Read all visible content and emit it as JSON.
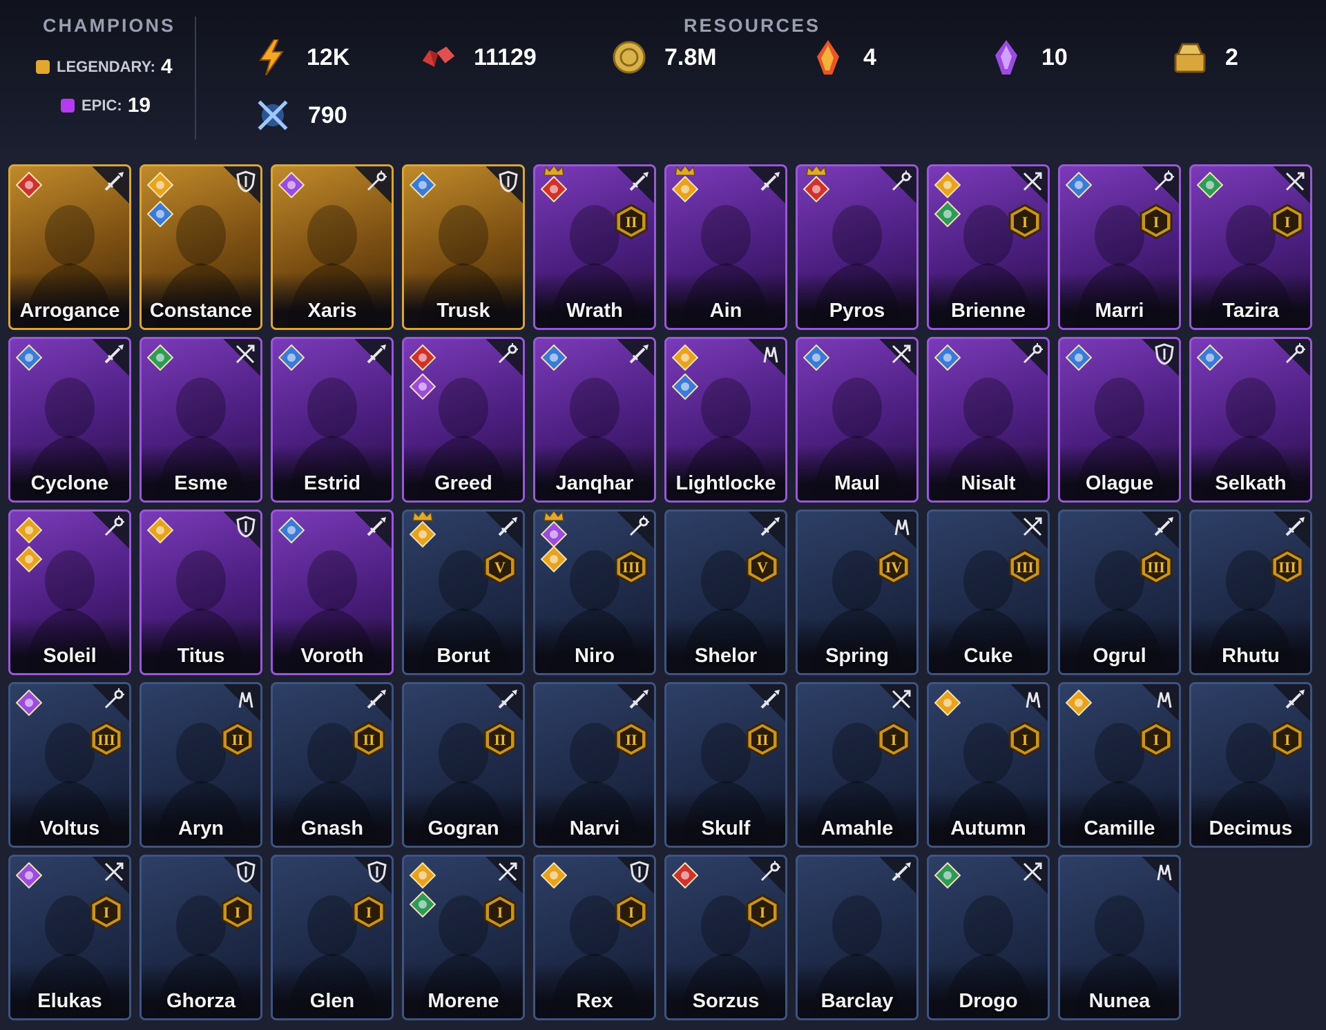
{
  "header": {
    "champions_title": "CHAMPIONS",
    "resources_title": "RESOURCES",
    "legendary_label": "LEGENDARY:",
    "legendary_count": "4",
    "epic_label": "EPIC:",
    "epic_count": "19",
    "resources": [
      {
        "icon": "lightning-energy-icon",
        "value": "12K"
      },
      {
        "icon": "red-gem-icon",
        "value": "11129"
      },
      {
        "icon": "gold-coin-icon",
        "value": "7.8M"
      },
      {
        "icon": "fire-shard-icon",
        "value": "4"
      },
      {
        "icon": "void-shard-icon",
        "value": "10"
      },
      {
        "icon": "gold-chest-icon",
        "value": "2"
      },
      {
        "icon": "crossed-swords-arena-icon",
        "value": "790"
      }
    ]
  },
  "colors": {
    "legendary": "#e0a82e",
    "epic": "#b33bf2",
    "rare": "#3e5482"
  },
  "champions": [
    {
      "name": "Arrogance",
      "rarity": "legendary",
      "affinity": "force",
      "role": "attack",
      "rank": ""
    },
    {
      "name": "Constance",
      "rarity": "legendary",
      "affinity": "spirit",
      "affinity2": "magic",
      "role": "defense",
      "rank": ""
    },
    {
      "name": "Xaris",
      "rarity": "legendary",
      "affinity": "void",
      "role": "support",
      "rank": ""
    },
    {
      "name": "Trusk",
      "rarity": "legendary",
      "affinity": "magic",
      "role": "defense",
      "rank": ""
    },
    {
      "name": "Wrath",
      "rarity": "epic",
      "affinity": "force",
      "role": "attack",
      "rank": "II",
      "crown": true
    },
    {
      "name": "Ain",
      "rarity": "epic",
      "affinity": "spirit",
      "role": "attack",
      "rank": "",
      "crown": true
    },
    {
      "name": "Pyros",
      "rarity": "epic",
      "affinity": "force",
      "role": "support",
      "rank": "",
      "crown": true
    },
    {
      "name": "Brienne",
      "rarity": "epic",
      "affinity": "spirit",
      "affinity2": "nature",
      "role": "ranged",
      "rank": "I"
    },
    {
      "name": "Marri",
      "rarity": "epic",
      "affinity": "magic",
      "role": "support",
      "rank": "I"
    },
    {
      "name": "Tazira",
      "rarity": "epic",
      "affinity": "nature",
      "role": "ranged",
      "rank": "I"
    },
    {
      "name": "Cyclone",
      "rarity": "epic",
      "affinity": "magic",
      "role": "attack",
      "rank": ""
    },
    {
      "name": "Esme",
      "rarity": "epic",
      "affinity": "nature",
      "role": "ranged",
      "rank": ""
    },
    {
      "name": "Estrid",
      "rarity": "epic",
      "affinity": "magic",
      "role": "attack",
      "rank": ""
    },
    {
      "name": "Greed",
      "rarity": "epic",
      "affinity": "force",
      "affinity2": "void",
      "role": "support",
      "rank": ""
    },
    {
      "name": "Janqhar",
      "rarity": "epic",
      "affinity": "magic",
      "role": "attack",
      "rank": ""
    },
    {
      "name": "Lightlocke",
      "rarity": "epic",
      "affinity": "spirit",
      "affinity2": "magic",
      "role": "heal",
      "rank": ""
    },
    {
      "name": "Maul",
      "rarity": "epic",
      "affinity": "magic",
      "role": "ranged",
      "rank": ""
    },
    {
      "name": "Nisalt",
      "rarity": "epic",
      "affinity": "magic",
      "role": "support",
      "rank": ""
    },
    {
      "name": "Olague",
      "rarity": "epic",
      "affinity": "magic",
      "role": "defense",
      "rank": ""
    },
    {
      "name": "Selkath",
      "rarity": "epic",
      "affinity": "magic",
      "role": "support",
      "rank": ""
    },
    {
      "name": "Soleil",
      "rarity": "epic",
      "affinity": "spirit",
      "affinity2": "spirit",
      "role": "support",
      "rank": ""
    },
    {
      "name": "Titus",
      "rarity": "epic",
      "affinity": "spirit",
      "role": "defense",
      "rank": ""
    },
    {
      "name": "Voroth",
      "rarity": "epic",
      "affinity": "magic",
      "role": "attack",
      "rank": ""
    },
    {
      "name": "Borut",
      "rarity": "rare",
      "affinity": "spirit",
      "role": "attack",
      "rank": "V",
      "crown": true
    },
    {
      "name": "Niro",
      "rarity": "rare",
      "affinity": "void",
      "affinity2": "spirit",
      "role": "support",
      "rank": "III",
      "crown": true
    },
    {
      "name": "Shelor",
      "rarity": "rare",
      "affinity": "",
      "role": "attack",
      "rank": "V"
    },
    {
      "name": "Spring",
      "rarity": "rare",
      "affinity": "",
      "role": "heal",
      "rank": "IV"
    },
    {
      "name": "Cuke",
      "rarity": "rare",
      "affinity": "",
      "role": "ranged",
      "rank": "III"
    },
    {
      "name": "Ogrul",
      "rarity": "rare",
      "affinity": "",
      "role": "attack",
      "rank": "III"
    },
    {
      "name": "Rhutu",
      "rarity": "rare",
      "affinity": "",
      "role": "attack",
      "rank": "III"
    },
    {
      "name": "Voltus",
      "rarity": "rare",
      "affinity": "void",
      "role": "support",
      "rank": "III"
    },
    {
      "name": "Aryn",
      "rarity": "rare",
      "affinity": "",
      "role": "heal",
      "rank": "II"
    },
    {
      "name": "Gnash",
      "rarity": "rare",
      "affinity": "",
      "role": "attack",
      "rank": "II"
    },
    {
      "name": "Gogran",
      "rarity": "rare",
      "affinity": "",
      "role": "attack",
      "rank": "II"
    },
    {
      "name": "Narvi",
      "rarity": "rare",
      "affinity": "",
      "role": "attack",
      "rank": "II"
    },
    {
      "name": "Skulf",
      "rarity": "rare",
      "affinity": "",
      "role": "attack",
      "rank": "II"
    },
    {
      "name": "Amahle",
      "rarity": "rare",
      "affinity": "",
      "role": "ranged",
      "rank": "I"
    },
    {
      "name": "Autumn",
      "rarity": "rare",
      "affinity": "spirit",
      "role": "heal",
      "rank": "I"
    },
    {
      "name": "Camille",
      "rarity": "rare",
      "affinity": "spirit",
      "role": "heal",
      "rank": "I"
    },
    {
      "name": "Decimus",
      "rarity": "rare",
      "affinity": "",
      "role": "attack",
      "rank": "I"
    },
    {
      "name": "Elukas",
      "rarity": "rare",
      "affinity": "void",
      "role": "ranged",
      "rank": "I"
    },
    {
      "name": "Ghorza",
      "rarity": "rare",
      "affinity": "",
      "role": "defense",
      "rank": "I"
    },
    {
      "name": "Glen",
      "rarity": "rare",
      "affinity": "",
      "role": "defense",
      "rank": "I"
    },
    {
      "name": "Morene",
      "rarity": "rare",
      "affinity": "spirit",
      "affinity2": "nature",
      "role": "ranged",
      "rank": "I"
    },
    {
      "name": "Rex",
      "rarity": "rare",
      "affinity": "spirit",
      "role": "defense",
      "rank": "I"
    },
    {
      "name": "Sorzus",
      "rarity": "rare",
      "affinity": "force",
      "role": "support",
      "rank": "I"
    },
    {
      "name": "Barclay",
      "rarity": "rare",
      "affinity": "",
      "role": "attack",
      "rank": ""
    },
    {
      "name": "Drogo",
      "rarity": "rare",
      "affinity": "nature",
      "role": "ranged",
      "rank": ""
    },
    {
      "name": "Nunea",
      "rarity": "rare",
      "affinity": "",
      "role": "heal",
      "rank": ""
    }
  ]
}
